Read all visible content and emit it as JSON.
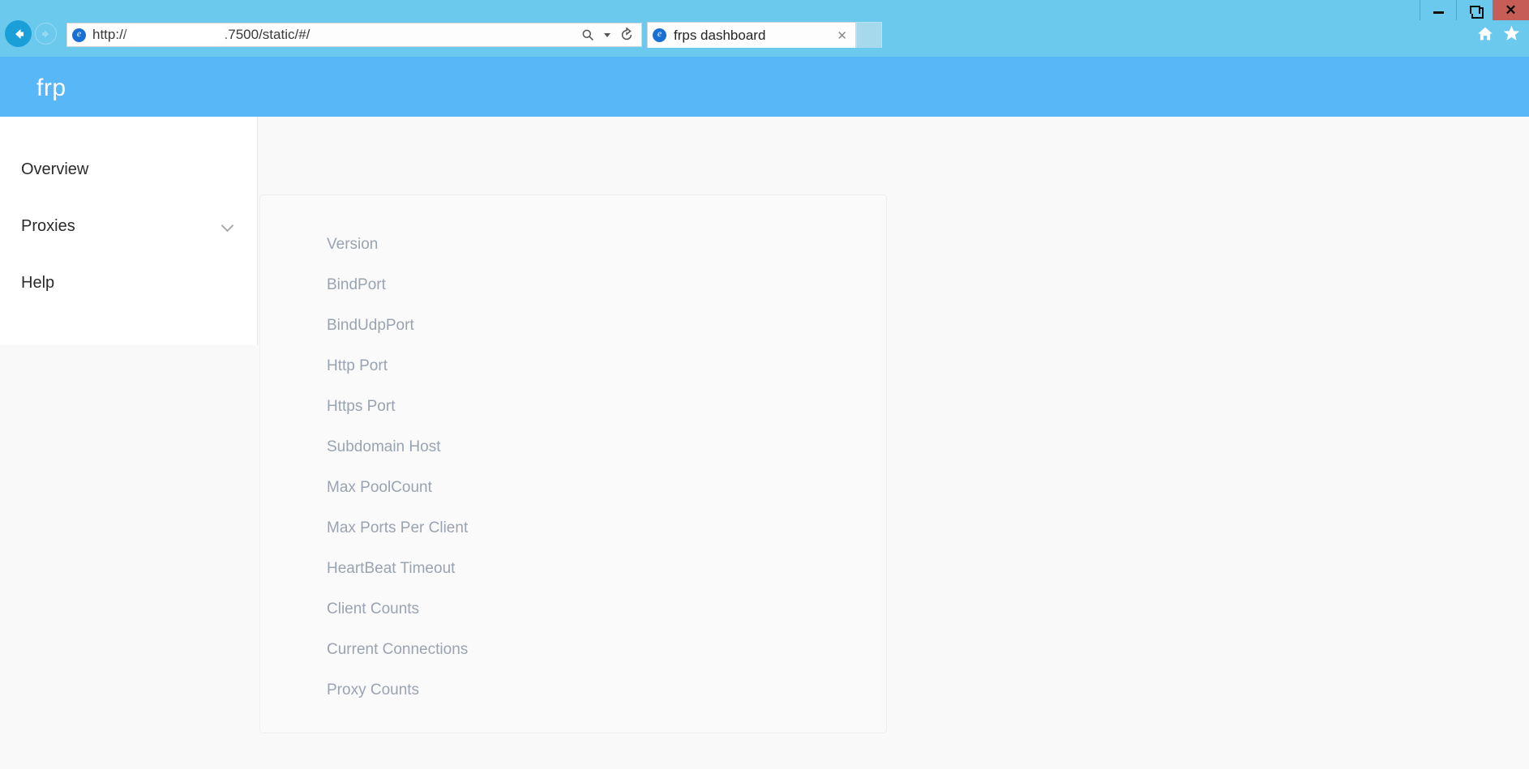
{
  "browser": {
    "window_controls": [
      {
        "name": "minimize",
        "glyph": "minimize-icon"
      },
      {
        "name": "maximize",
        "glyph": "restore-icon"
      },
      {
        "name": "close",
        "glyph": "✕"
      }
    ],
    "back_label": "Back",
    "forward_label": "Forward",
    "url_prefix": "http://",
    "url_redacted": "",
    "url_suffix": ".7500/static/#/",
    "search_icon": "search-icon",
    "refresh_icon": "refresh-icon",
    "tab": {
      "title": "frps dashboard",
      "close_label": "✕"
    },
    "new_tab_label": "",
    "home_icon": "home-icon",
    "favorites_icon": "star-icon",
    "chrome_color": "#6bc9ee",
    "accent_color": "#1b9fd8"
  },
  "app": {
    "logo": "frp",
    "header_color": "#58b7f6"
  },
  "sidebar": {
    "items": [
      {
        "label": "Overview",
        "has_chevron": false
      },
      {
        "label": "Proxies",
        "has_chevron": true,
        "chevron": "chevron-down-icon"
      },
      {
        "label": "Help",
        "has_chevron": false
      }
    ]
  },
  "main": {
    "card": {
      "rows": [
        {
          "label": "Version",
          "value": ""
        },
        {
          "label": "BindPort",
          "value": ""
        },
        {
          "label": "BindUdpPort",
          "value": ""
        },
        {
          "label": "Http Port",
          "value": ""
        },
        {
          "label": "Https Port",
          "value": ""
        },
        {
          "label": "Subdomain Host",
          "value": ""
        },
        {
          "label": "Max PoolCount",
          "value": ""
        },
        {
          "label": "Max Ports Per Client",
          "value": ""
        },
        {
          "label": "HeartBeat Timeout",
          "value": ""
        },
        {
          "label": "Client Counts",
          "value": ""
        },
        {
          "label": "Current Connections",
          "value": ""
        },
        {
          "label": "Proxy Counts",
          "value": ""
        }
      ],
      "label_color": "#9aa3b0",
      "background": "#fafafb"
    }
  }
}
